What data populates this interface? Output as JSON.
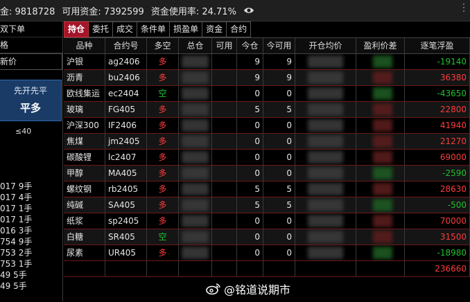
{
  "account": {
    "balance_text": "金: 9818728",
    "available_text": "可用资金: 7392599",
    "usage_text": "资金使用率: 24.71%"
  },
  "order_panel": {
    "quick_order": "双下单",
    "price_label": "格",
    "price_value": "新价",
    "button_line1": "先开先平",
    "button_line2": "平多",
    "limit_text": "≤40",
    "recent": [
      "017 9手",
      "017 4手",
      "017 1手",
      "017 1手",
      "016 3手",
      "754 9手",
      "753 2手",
      "753 1手",
      "49 5手",
      "49 5手"
    ]
  },
  "tabs": [
    "持仓",
    "委托",
    "成交",
    "条件单",
    "损盈单",
    "资金",
    "合约"
  ],
  "active_tab": 0,
  "columns": [
    "品种",
    "合约号",
    "多空",
    "总仓",
    "可用",
    "今仓",
    "今可用",
    "开仓均价",
    "盈利价差",
    "逐笔浮盈"
  ],
  "rows": [
    {
      "name": "沪银",
      "code": "ag2406",
      "side": "多",
      "today": "9",
      "today_avail": "9",
      "pnl": "-19140",
      "side_color": "#ff3b3b",
      "pnl_color": "#1fc22e"
    },
    {
      "name": "沥青",
      "code": "bu2406",
      "side": "多",
      "today": "9",
      "today_avail": "9",
      "pnl": "36380",
      "side_color": "#ff3b3b",
      "pnl_color": "#ff3b3b"
    },
    {
      "name": "欧线集运",
      "code": "ec2404",
      "side": "空",
      "today": "0",
      "today_avail": "0",
      "pnl": "-43650",
      "side_color": "#1fc22e",
      "pnl_color": "#1fc22e"
    },
    {
      "name": "玻璃",
      "code": "FG405",
      "side": "多",
      "today": "5",
      "today_avail": "5",
      "pnl": "22800",
      "side_color": "#ff3b3b",
      "pnl_color": "#ff3b3b"
    },
    {
      "name": "沪深300",
      "code": "IF2406",
      "side": "多",
      "today": "0",
      "today_avail": "0",
      "pnl": "41940",
      "side_color": "#ff3b3b",
      "pnl_color": "#ff3b3b"
    },
    {
      "name": "焦煤",
      "code": "jm2405",
      "side": "多",
      "today": "0",
      "today_avail": "0",
      "pnl": "21270",
      "side_color": "#ff3b3b",
      "pnl_color": "#ff3b3b"
    },
    {
      "name": "碳酸锂",
      "code": "lc2407",
      "side": "多",
      "today": "0",
      "today_avail": "0",
      "pnl": "69000",
      "side_color": "#ff3b3b",
      "pnl_color": "#ff3b3b"
    },
    {
      "name": "甲醇",
      "code": "MA405",
      "side": "多",
      "today": "0",
      "today_avail": "0",
      "pnl": "-2590",
      "side_color": "#ff3b3b",
      "pnl_color": "#1fc22e"
    },
    {
      "name": "螺纹钢",
      "code": "rb2405",
      "side": "多",
      "today": "5",
      "today_avail": "5",
      "pnl": "28630",
      "side_color": "#ff3b3b",
      "pnl_color": "#ff3b3b"
    },
    {
      "name": "纯碱",
      "code": "SA405",
      "side": "多",
      "today": "5",
      "today_avail": "5",
      "pnl": "-500",
      "side_color": "#ff3b3b",
      "pnl_color": "#1fc22e"
    },
    {
      "name": "纸浆",
      "code": "sp2405",
      "side": "多",
      "today": "0",
      "today_avail": "0",
      "pnl": "70000",
      "side_color": "#ff3b3b",
      "pnl_color": "#ff3b3b"
    },
    {
      "name": "白糖",
      "code": "SR405",
      "side": "空",
      "today": "0",
      "today_avail": "0",
      "pnl": "31500",
      "side_color": "#1fc22e",
      "pnl_color": "#ff3b3b"
    },
    {
      "name": "尿素",
      "code": "UR405",
      "side": "多",
      "today": "0",
      "today_avail": "0",
      "pnl": "-18980",
      "side_color": "#ff3b3b",
      "pnl_color": "#1fc22e"
    }
  ],
  "total_pnl": "236660",
  "total_color": "#ff3b3b",
  "watermark": "@铭道说期市"
}
